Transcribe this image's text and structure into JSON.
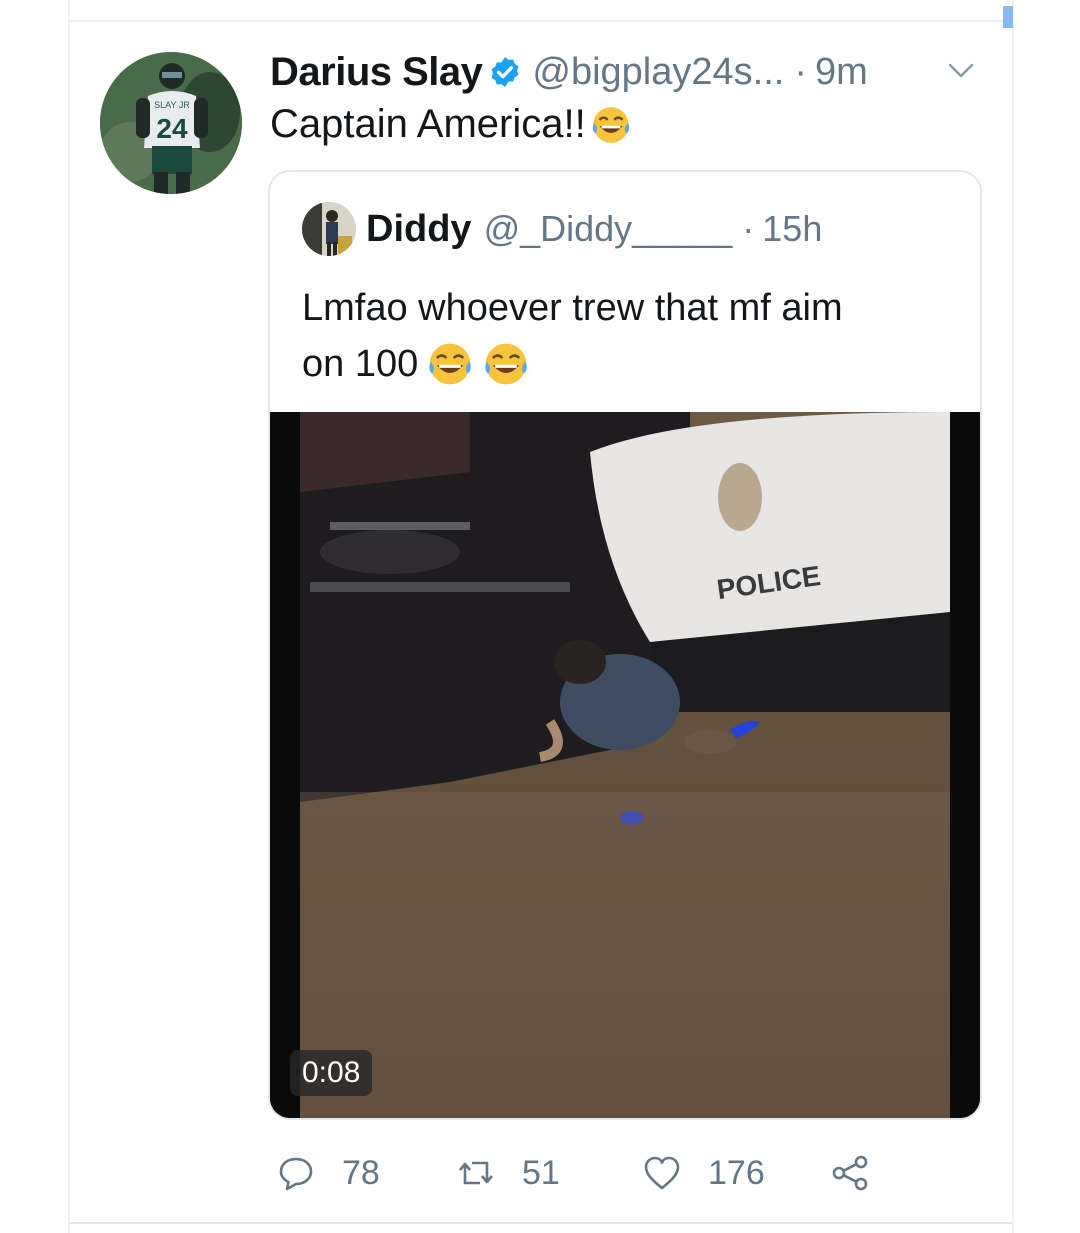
{
  "tweet": {
    "author_name": "Darius Slay",
    "handle": "@bigplay24s...",
    "separator": "·",
    "time": "9m",
    "text": "Captain America!!",
    "avatar_jersey_number": "24",
    "avatar_jersey_name": "SLAY JR"
  },
  "quote": {
    "author_name": "Diddy",
    "handle": "@_Diddy_____",
    "separator": "·",
    "time": "15h",
    "text_line1": "Lmfao whoever trew that mf aim",
    "text_line2": "on 100",
    "video_duration": "0:08",
    "video_overlay_text": "POLICE"
  },
  "actions": {
    "replies": "78",
    "retweets": "51",
    "likes": "176"
  },
  "colors": {
    "verified": "#1da1f2",
    "secondary_text": "#657786",
    "card_border": "#e1e8ed"
  }
}
